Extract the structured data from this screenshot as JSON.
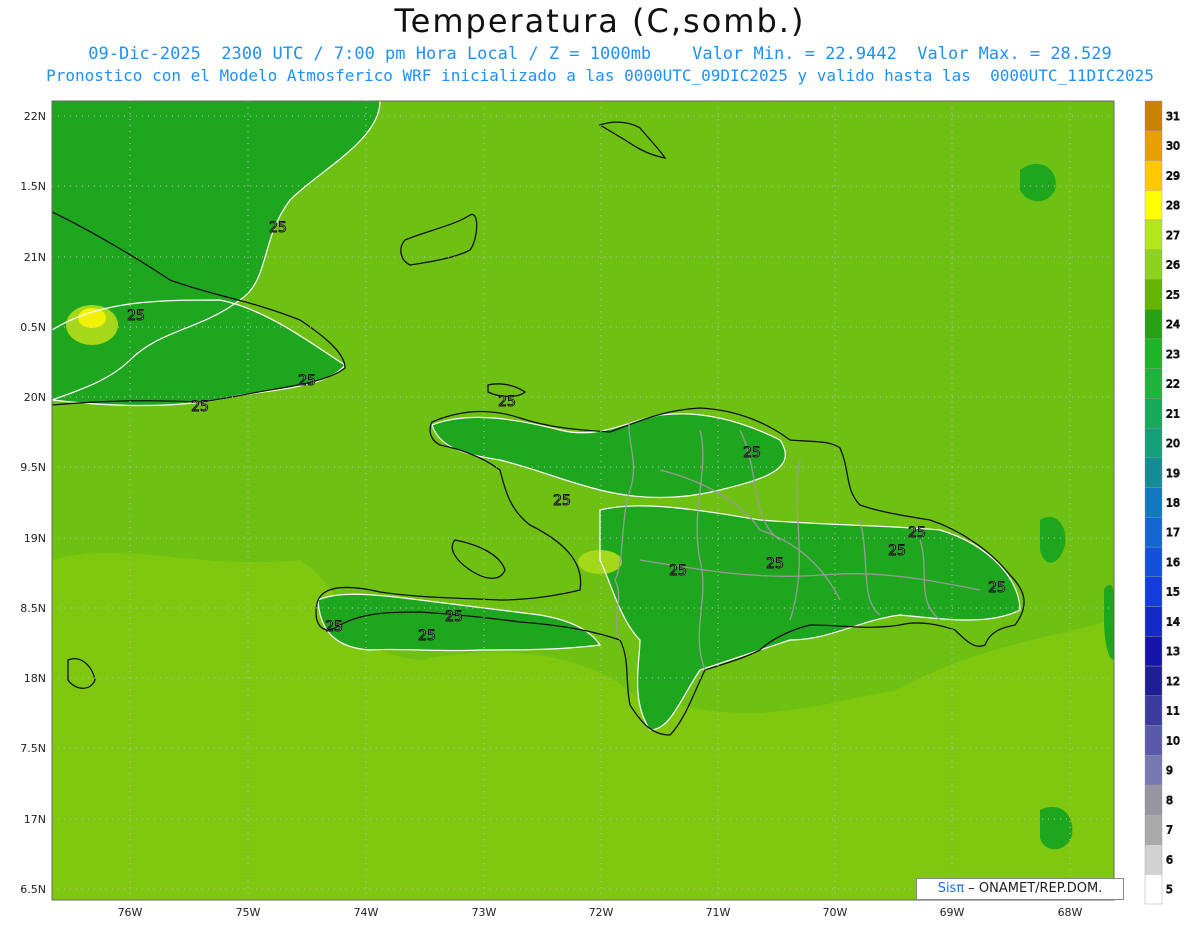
{
  "header": {
    "title": "Temperatura (C,somb.)",
    "line1": "09-Dic-2025  2300 UTC / 7:00 pm Hora Local / Z = 1000mb    Valor Min. = 22.9442  Valor Max. = 28.529",
    "line2": "Pronostico con el Modelo Atmosferico WRF inicializado a las 0000UTC_09DIC2025 y valido hasta las  0000UTC_11DIC2025"
  },
  "map": {
    "lat_labels": [
      "22N",
      "1.5N",
      "21N",
      "0.5N",
      "20N",
      "9.5N",
      "19N",
      "8.5N",
      "18N",
      "7.5N",
      "17N",
      "6.5N"
    ],
    "lon_labels": [
      "76W",
      "75W",
      "74W",
      "73W",
      "72W",
      "71W",
      "70W",
      "69W",
      "68W"
    ],
    "contour_labels": [
      "25",
      "25",
      "25",
      "25",
      "25",
      "25",
      "25",
      "25",
      "25",
      "25",
      "25",
      "25",
      "25",
      "25",
      "25"
    ],
    "colors": {
      "t24": "#1fa61f",
      "t25": "#5fb811",
      "t26": "#80c80f",
      "t27": "#a6d81a",
      "t28": "#f2f200",
      "coast": "#111111",
      "border": "#9a9a9a",
      "contour": "#ffffff",
      "grid": "#b8b8b8"
    }
  },
  "colorbar": {
    "levels": [
      "31",
      "30",
      "29",
      "28",
      "27",
      "26",
      "25",
      "24",
      "23",
      "22",
      "21",
      "20",
      "19",
      "18",
      "17",
      "16",
      "15",
      "14",
      "13",
      "12",
      "11",
      "10",
      "9",
      "8",
      "7",
      "6",
      "5"
    ],
    "colors": [
      "#c88400",
      "#e6a000",
      "#ffc800",
      "#ffff00",
      "#b4e61e",
      "#8cd21e",
      "#64b400",
      "#28a014",
      "#1eb428",
      "#1eb43c",
      "#14aa5a",
      "#14a078",
      "#148c96",
      "#1478be",
      "#1464d2",
      "#1450dc",
      "#143cdc",
      "#1428c8",
      "#1414aa",
      "#1e1e96",
      "#3c3ca0",
      "#5a5aaa",
      "#7878b4",
      "#9696a0",
      "#aaaaaa",
      "#d2d2d2",
      "#ffffff"
    ]
  },
  "footer": {
    "brand": "SisPi",
    "brand_symbol": "Sisπ",
    "credit": " – ONAMET/REP.DOM."
  }
}
